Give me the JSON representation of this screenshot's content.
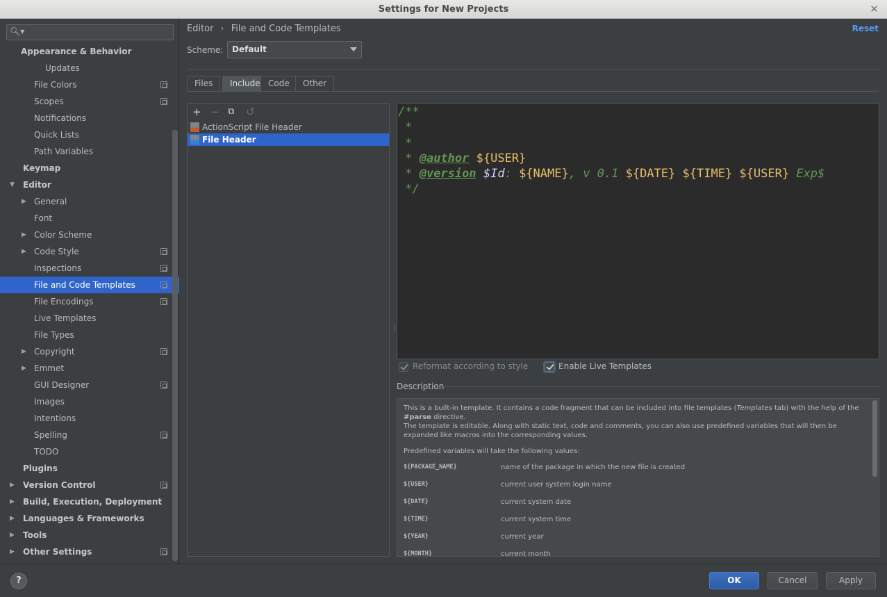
{
  "window": {
    "title": "Settings for New Projects",
    "close_icon": "close-icon"
  },
  "search": {
    "placeholder": ""
  },
  "tree": [
    {
      "label": "Appearance & Behavior",
      "level": 0,
      "bold": true,
      "arrow": ""
    },
    {
      "label": "Updates",
      "level": 2,
      "bold": false,
      "arrow": ""
    },
    {
      "label": "File Colors",
      "level": 1,
      "bold": false,
      "arrow": "",
      "copy": true
    },
    {
      "label": "Scopes",
      "level": 1,
      "bold": false,
      "arrow": "",
      "copy": true
    },
    {
      "label": "Notifications",
      "level": 1,
      "bold": false,
      "arrow": ""
    },
    {
      "label": "Quick Lists",
      "level": 1,
      "bold": false,
      "arrow": ""
    },
    {
      "label": "Path Variables",
      "level": 1,
      "bold": false,
      "arrow": ""
    },
    {
      "label": "Keymap",
      "level": 0,
      "bold": true,
      "arrow": ""
    },
    {
      "label": "Editor",
      "level": 0,
      "bold": true,
      "arrow": "expanded"
    },
    {
      "label": "General",
      "level": 1,
      "bold": false,
      "arrow": "collapsed"
    },
    {
      "label": "Font",
      "level": 1,
      "bold": false,
      "arrow": ""
    },
    {
      "label": "Color Scheme",
      "level": 1,
      "bold": false,
      "arrow": "collapsed"
    },
    {
      "label": "Code Style",
      "level": 1,
      "bold": false,
      "arrow": "collapsed",
      "copy": true
    },
    {
      "label": "Inspections",
      "level": 1,
      "bold": false,
      "arrow": "",
      "copy": true
    },
    {
      "label": "File and Code Templates",
      "level": 1,
      "bold": false,
      "arrow": "",
      "copy": true,
      "selected": true
    },
    {
      "label": "File Encodings",
      "level": 1,
      "bold": false,
      "arrow": "",
      "copy": true
    },
    {
      "label": "Live Templates",
      "level": 1,
      "bold": false,
      "arrow": ""
    },
    {
      "label": "File Types",
      "level": 1,
      "bold": false,
      "arrow": ""
    },
    {
      "label": "Copyright",
      "level": 1,
      "bold": false,
      "arrow": "collapsed",
      "copy": true
    },
    {
      "label": "Emmet",
      "level": 1,
      "bold": false,
      "arrow": "collapsed"
    },
    {
      "label": "GUI Designer",
      "level": 1,
      "bold": false,
      "arrow": "",
      "copy": true
    },
    {
      "label": "Images",
      "level": 1,
      "bold": false,
      "arrow": ""
    },
    {
      "label": "Intentions",
      "level": 1,
      "bold": false,
      "arrow": ""
    },
    {
      "label": "Spelling",
      "level": 1,
      "bold": false,
      "arrow": "",
      "copy": true
    },
    {
      "label": "TODO",
      "level": 1,
      "bold": false,
      "arrow": ""
    },
    {
      "label": "Plugins",
      "level": 0,
      "bold": true,
      "arrow": ""
    },
    {
      "label": "Version Control",
      "level": 0,
      "bold": true,
      "arrow": "collapsed",
      "copy": true
    },
    {
      "label": "Build, Execution, Deployment",
      "level": 0,
      "bold": true,
      "arrow": "collapsed"
    },
    {
      "label": "Languages & Frameworks",
      "level": 0,
      "bold": true,
      "arrow": "collapsed"
    },
    {
      "label": "Tools",
      "level": 0,
      "bold": true,
      "arrow": "collapsed"
    },
    {
      "label": "Other Settings",
      "level": 0,
      "bold": true,
      "arrow": "collapsed",
      "copy": true
    }
  ],
  "breadcrumb": {
    "parent": "Editor",
    "separator": "›",
    "current": "File and Code Templates"
  },
  "reset_label": "Reset",
  "scheme": {
    "label": "Scheme:",
    "value": "Default"
  },
  "tabs": [
    {
      "label": "Files",
      "active": false
    },
    {
      "label": "Includes",
      "active": true
    },
    {
      "label": "Code",
      "active": false
    },
    {
      "label": "Other",
      "active": false
    }
  ],
  "list_tools": {
    "add": "+",
    "remove": "−",
    "copy": "⧉",
    "revert": "↺"
  },
  "templates": [
    {
      "label": "ActionScript File Header",
      "icon": "as",
      "selected": false
    },
    {
      "label": "File Header",
      "icon": "fh",
      "selected": true
    }
  ],
  "code": {
    "l1": "/**",
    "l2": " *",
    "l3": " *",
    "star": " * ",
    "author_tag": "@author",
    "author_var": "${USER}",
    "version_tag": "@version",
    "id_var": "$Id",
    "colon": ": ",
    "name_var": "${NAME}",
    "ver_text": ", v 0.1 ",
    "date_var": "${DATE}",
    "time_var": "${TIME}",
    "user_var": "${USER}",
    "exp_text": "Exp$",
    "end": " */"
  },
  "options": {
    "reformat_label": "Reformat according to style",
    "reformat_checked": true,
    "live_label": "Enable Live Templates",
    "live_checked": true
  },
  "description": {
    "title": "Description",
    "p1_a": "This is a built-in template. It contains a code fragment that can be included into file templates (",
    "p1_em": "Templates",
    "p1_b": " tab) with the help of the ",
    "p1_code": "#parse",
    "p1_c": " directive.",
    "p2": "The template is editable. Along with static text, code and comments, you can also use predefined variables that will then be expanded like macros into the corresponding values.",
    "p3": "Predefined variables will take the following values:",
    "vars": [
      {
        "name": "${PACKAGE_NAME}",
        "desc": "name of the package in which the new file is created"
      },
      {
        "name": "${USER}",
        "desc": "current user system login name"
      },
      {
        "name": "${DATE}",
        "desc": "current system date"
      },
      {
        "name": "${TIME}",
        "desc": "current system time"
      },
      {
        "name": "${YEAR}",
        "desc": "current year"
      },
      {
        "name": "${MONTH}",
        "desc": "current month"
      }
    ]
  },
  "footer": {
    "help": "?",
    "ok": "OK",
    "cancel": "Cancel",
    "apply": "Apply"
  }
}
